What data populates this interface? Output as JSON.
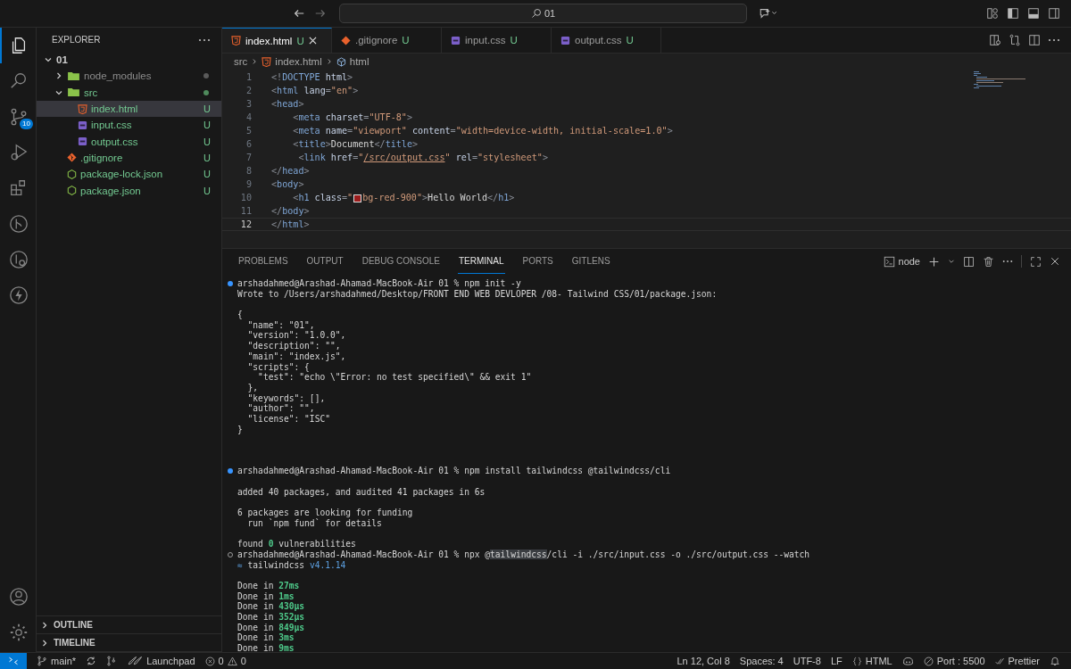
{
  "title_bar": {
    "search": "01"
  },
  "activity": [
    {
      "kind": "explorer",
      "selected": true
    },
    {
      "kind": "search",
      "selected": false
    },
    {
      "kind": "source-control",
      "selected": false,
      "badge": "10"
    },
    {
      "kind": "run",
      "selected": false
    },
    {
      "kind": "extensions",
      "selected": false
    },
    {
      "kind": "git-graph",
      "selected": false
    },
    {
      "kind": "gitlens",
      "selected": false
    },
    {
      "kind": "bolt",
      "selected": false
    }
  ],
  "sidebar": {
    "title": "EXPLORER",
    "tree": [
      {
        "label": "01",
        "kind": "root",
        "expanded": true,
        "selected": false,
        "children": [
          {
            "label": "node_modules",
            "kind": "folder",
            "expanded": false,
            "untracked": false,
            "dot": true,
            "selected": false
          },
          {
            "label": "src",
            "kind": "folder",
            "expanded": true,
            "untracked": true,
            "dot": true,
            "selected": false,
            "children": [
              {
                "label": "index.html",
                "kind": "html",
                "untracked": true,
                "badge": "U",
                "selected": true
              },
              {
                "label": "input.css",
                "kind": "css",
                "untracked": true,
                "badge": "U",
                "selected": false
              },
              {
                "label": "output.css",
                "kind": "css",
                "untracked": true,
                "badge": "U",
                "selected": false
              }
            ]
          },
          {
            "label": ".gitignore",
            "kind": "git",
            "untracked": true,
            "badge": "U",
            "selected": false
          },
          {
            "label": "package-lock.json",
            "kind": "json",
            "untracked": true,
            "badge": "U",
            "selected": false
          },
          {
            "label": "package.json",
            "kind": "json",
            "untracked": true,
            "badge": "U",
            "selected": false
          }
        ]
      }
    ],
    "sections": [
      {
        "label": "OUTLINE",
        "expanded": false
      },
      {
        "label": "TIMELINE",
        "expanded": false
      }
    ]
  },
  "tabs": [
    {
      "label": "index.html",
      "kind": "html",
      "badge": "U",
      "selected": true
    },
    {
      "label": ".gitignore",
      "kind": "git",
      "badge": "U",
      "selected": false
    },
    {
      "label": "input.css",
      "kind": "css",
      "badge": "U",
      "selected": false
    },
    {
      "label": "output.css",
      "kind": "css",
      "badge": "U",
      "selected": false
    }
  ],
  "breadcrumb": [
    {
      "label": "src",
      "kind": "folder"
    },
    {
      "label": "index.html",
      "kind": "html"
    },
    {
      "label": "html",
      "kind": "element"
    }
  ],
  "code": [
    {
      "number": "1",
      "current": false,
      "tokens": [
        {
          "kind": "punct",
          "text": "<!"
        },
        {
          "kind": "tag",
          "text": "DOCTYPE"
        },
        {
          "kind": "attr",
          "text": " html"
        },
        {
          "kind": "punct",
          "text": ">"
        }
      ]
    },
    {
      "number": "2",
      "current": false,
      "tokens": [
        {
          "kind": "punct",
          "text": "<"
        },
        {
          "kind": "tag",
          "text": "html"
        },
        {
          "kind": "attr",
          "text": " lang"
        },
        {
          "kind": "punct",
          "text": "="
        },
        {
          "kind": "string",
          "text": "\"en\""
        },
        {
          "kind": "punct",
          "text": ">"
        }
      ]
    },
    {
      "number": "3",
      "current": false,
      "tokens": [
        {
          "kind": "punct",
          "text": "<"
        },
        {
          "kind": "tag",
          "text": "head"
        },
        {
          "kind": "punct",
          "text": ">"
        }
      ]
    },
    {
      "number": "4",
      "current": false,
      "tokens": [
        {
          "kind": "punct",
          "text": "    <"
        },
        {
          "kind": "tag",
          "text": "meta"
        },
        {
          "kind": "attr",
          "text": " charset"
        },
        {
          "kind": "punct",
          "text": "="
        },
        {
          "kind": "string",
          "text": "\"UTF-8\""
        },
        {
          "kind": "punct",
          "text": ">"
        }
      ]
    },
    {
      "number": "5",
      "current": false,
      "tokens": [
        {
          "kind": "punct",
          "text": "    <"
        },
        {
          "kind": "tag",
          "text": "meta"
        },
        {
          "kind": "attr",
          "text": " name"
        },
        {
          "kind": "punct",
          "text": "="
        },
        {
          "kind": "string",
          "text": "\"viewport\""
        },
        {
          "kind": "attr",
          "text": " content"
        },
        {
          "kind": "punct",
          "text": "="
        },
        {
          "kind": "string",
          "text": "\"width=device-width, initial-scale=1.0\""
        },
        {
          "kind": "punct",
          "text": ">"
        }
      ]
    },
    {
      "number": "6",
      "current": false,
      "tokens": [
        {
          "kind": "punct",
          "text": "    <"
        },
        {
          "kind": "tag",
          "text": "title"
        },
        {
          "kind": "punct",
          "text": ">"
        },
        {
          "kind": "text",
          "text": "Document"
        },
        {
          "kind": "punct",
          "text": "</"
        },
        {
          "kind": "tag",
          "text": "title"
        },
        {
          "kind": "punct",
          "text": ">"
        }
      ]
    },
    {
      "number": "7",
      "current": false,
      "tokens": [
        {
          "kind": "punct",
          "text": "     <"
        },
        {
          "kind": "tag",
          "text": "link"
        },
        {
          "kind": "attr",
          "text": " href"
        },
        {
          "kind": "punct",
          "text": "="
        },
        {
          "kind": "string",
          "text": "\""
        },
        {
          "kind": "link",
          "text": "/src/output.css"
        },
        {
          "kind": "string",
          "text": "\""
        },
        {
          "kind": "attr",
          "text": " rel"
        },
        {
          "kind": "punct",
          "text": "="
        },
        {
          "kind": "string",
          "text": "\"stylesheet\""
        },
        {
          "kind": "punct",
          "text": ">"
        }
      ]
    },
    {
      "number": "8",
      "current": false,
      "tokens": [
        {
          "kind": "punct",
          "text": "</"
        },
        {
          "kind": "tag",
          "text": "head"
        },
        {
          "kind": "punct",
          "text": ">"
        }
      ]
    },
    {
      "number": "9",
      "current": false,
      "tokens": [
        {
          "kind": "punct",
          "text": "<"
        },
        {
          "kind": "tag",
          "text": "body"
        },
        {
          "kind": "punct",
          "text": ">"
        }
      ]
    },
    {
      "number": "10",
      "current": false,
      "tokens": [
        {
          "kind": "punct",
          "text": "    <"
        },
        {
          "kind": "tag",
          "text": "h1"
        },
        {
          "kind": "attr",
          "text": " class"
        },
        {
          "kind": "punct",
          "text": "="
        },
        {
          "kind": "string",
          "text": "\""
        },
        {
          "kind": "swatch",
          "color": "#9b1c1c"
        },
        {
          "kind": "string",
          "text": "bg-red-900\""
        },
        {
          "kind": "punct",
          "text": ">"
        },
        {
          "kind": "text",
          "text": "Hello World"
        },
        {
          "kind": "punct",
          "text": "</"
        },
        {
          "kind": "tag",
          "text": "h1"
        },
        {
          "kind": "punct",
          "text": ">"
        }
      ]
    },
    {
      "number": "11",
      "current": false,
      "tokens": [
        {
          "kind": "punct",
          "text": "</"
        },
        {
          "kind": "tag",
          "text": "body"
        },
        {
          "kind": "punct",
          "text": ">"
        }
      ]
    },
    {
      "number": "12",
      "current": true,
      "tokens": [
        {
          "kind": "punct",
          "text": "</"
        },
        {
          "kind": "tag",
          "text": "html"
        },
        {
          "kind": "punct",
          "text": ">"
        }
      ]
    }
  ],
  "panel": {
    "tabs": [
      {
        "label": "PROBLEMS",
        "selected": false
      },
      {
        "label": "OUTPUT",
        "selected": false
      },
      {
        "label": "DEBUG CONSOLE",
        "selected": false
      },
      {
        "label": "TERMINAL",
        "selected": true
      },
      {
        "label": "PORTS",
        "selected": false
      },
      {
        "label": "GITLENS",
        "selected": false
      }
    ],
    "shell": "node"
  },
  "terminal": [
    {
      "kind": "prompt",
      "running": false,
      "segments": [
        {
          "kind": "text",
          "text": "arshadahmed@Arashad-Ahamad-MacBook-Air 01 % npm init -y"
        }
      ]
    },
    {
      "kind": "output",
      "segments": [
        {
          "kind": "text",
          "text": "Wrote to /Users/arshadahmed/Desktop/FRONT END WEB DEVLOPER /08- Tailwind CSS/01/package.json:"
        }
      ]
    },
    {
      "kind": "blank"
    },
    {
      "kind": "output",
      "segments": [
        {
          "kind": "text",
          "text": "{"
        }
      ]
    },
    {
      "kind": "output",
      "segments": [
        {
          "kind": "text",
          "text": "  \"name\": \"01\","
        }
      ]
    },
    {
      "kind": "output",
      "segments": [
        {
          "kind": "text",
          "text": "  \"version\": \"1.0.0\","
        }
      ]
    },
    {
      "kind": "output",
      "segments": [
        {
          "kind": "text",
          "text": "  \"description\": \"\","
        }
      ]
    },
    {
      "kind": "output",
      "segments": [
        {
          "kind": "text",
          "text": "  \"main\": \"index.js\","
        }
      ]
    },
    {
      "kind": "output",
      "segments": [
        {
          "kind": "text",
          "text": "  \"scripts\": {"
        }
      ]
    },
    {
      "kind": "output",
      "segments": [
        {
          "kind": "text",
          "text": "    \"test\": \"echo \\\"Error: no test specified\\\" && exit 1\""
        }
      ]
    },
    {
      "kind": "output",
      "segments": [
        {
          "kind": "text",
          "text": "  },"
        }
      ]
    },
    {
      "kind": "output",
      "segments": [
        {
          "kind": "text",
          "text": "  \"keywords\": [],"
        }
      ]
    },
    {
      "kind": "output",
      "segments": [
        {
          "kind": "text",
          "text": "  \"author\": \"\","
        }
      ]
    },
    {
      "kind": "output",
      "segments": [
        {
          "kind": "text",
          "text": "  \"license\": \"ISC\""
        }
      ]
    },
    {
      "kind": "output",
      "segments": [
        {
          "kind": "text",
          "text": "}"
        }
      ]
    },
    {
      "kind": "blank"
    },
    {
      "kind": "blank"
    },
    {
      "kind": "blank"
    },
    {
      "kind": "prompt",
      "running": false,
      "segments": [
        {
          "kind": "text",
          "text": "arshadahmed@Arashad-Ahamad-MacBook-Air 01 % npm install tailwindcss @tailwindcss/cli"
        }
      ]
    },
    {
      "kind": "blank"
    },
    {
      "kind": "output",
      "segments": [
        {
          "kind": "text",
          "text": "added 40 packages, and audited 41 packages in 6s"
        }
      ]
    },
    {
      "kind": "blank"
    },
    {
      "kind": "output",
      "segments": [
        {
          "kind": "text",
          "text": "6 packages are looking for funding"
        }
      ]
    },
    {
      "kind": "output",
      "segments": [
        {
          "kind": "text",
          "text": "  run `npm fund` for details"
        }
      ]
    },
    {
      "kind": "blank"
    },
    {
      "kind": "output",
      "segments": [
        {
          "kind": "text",
          "text": "found "
        },
        {
          "kind": "ok",
          "text": "0"
        },
        {
          "kind": "text",
          "text": " vulnerabilities"
        }
      ]
    },
    {
      "kind": "prompt",
      "running": true,
      "segments": [
        {
          "kind": "text",
          "text": "arshadahmed@Arashad-Ahamad-MacBook-Air 01 % npx @"
        },
        {
          "kind": "match",
          "text": "tailwindcss"
        },
        {
          "kind": "text",
          "text": "/cli -i ./src/input.css -o ./src/output.css --watch"
        }
      ]
    },
    {
      "kind": "output",
      "segments": [
        {
          "kind": "info",
          "text": "≈"
        },
        {
          "kind": "text",
          "text": " tailwindcss "
        },
        {
          "kind": "info",
          "text": "v4.1.14"
        }
      ]
    },
    {
      "kind": "blank"
    },
    {
      "kind": "output",
      "segments": [
        {
          "kind": "text",
          "text": "Done in "
        },
        {
          "kind": "ok",
          "text": "27ms"
        }
      ]
    },
    {
      "kind": "output",
      "segments": [
        {
          "kind": "text",
          "text": "Done in "
        },
        {
          "kind": "ok",
          "text": "1ms"
        }
      ]
    },
    {
      "kind": "output",
      "segments": [
        {
          "kind": "text",
          "text": "Done in "
        },
        {
          "kind": "ok",
          "text": "430µs"
        }
      ]
    },
    {
      "kind": "output",
      "segments": [
        {
          "kind": "text",
          "text": "Done in "
        },
        {
          "kind": "ok",
          "text": "352µs"
        }
      ]
    },
    {
      "kind": "output",
      "segments": [
        {
          "kind": "text",
          "text": "Done in "
        },
        {
          "kind": "ok",
          "text": "849µs"
        }
      ]
    },
    {
      "kind": "output",
      "segments": [
        {
          "kind": "text",
          "text": "Done in "
        },
        {
          "kind": "ok",
          "text": "3ms"
        }
      ]
    },
    {
      "kind": "output",
      "segments": [
        {
          "kind": "text",
          "text": "Done in "
        },
        {
          "kind": "ok",
          "text": "9ms"
        }
      ]
    }
  ],
  "status_bar": {
    "left": [
      {
        "kind": "branch",
        "text": "main*"
      },
      {
        "kind": "sync"
      },
      {
        "kind": "graph"
      },
      {
        "kind": "launchpad",
        "text": "Launchpad"
      },
      {
        "kind": "problems",
        "errors": "0",
        "warnings": "0"
      }
    ],
    "right": [
      {
        "kind": "plain",
        "text": "Ln 12, Col 8"
      },
      {
        "kind": "plain",
        "text": "Spaces: 4"
      },
      {
        "kind": "plain",
        "text": "UTF-8"
      },
      {
        "kind": "plain",
        "text": "LF"
      },
      {
        "kind": "language",
        "text": "HTML"
      },
      {
        "kind": "copilot"
      },
      {
        "kind": "port",
        "text": "Port : 5500"
      },
      {
        "kind": "prettier",
        "text": "Prettier"
      },
      {
        "kind": "bell"
      }
    ]
  }
}
